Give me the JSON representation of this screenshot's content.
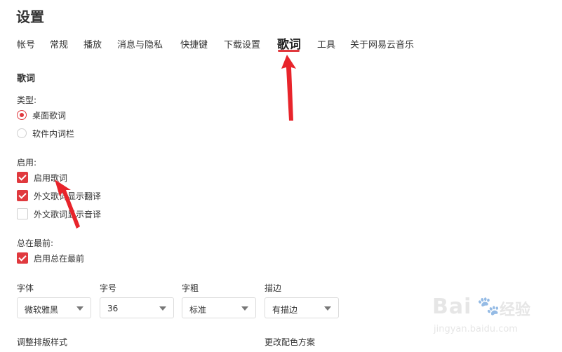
{
  "page": {
    "title": "设置"
  },
  "tabs": [
    {
      "label": "帐号"
    },
    {
      "label": "常规"
    },
    {
      "label": "播放"
    },
    {
      "label": "消息与隐私"
    },
    {
      "label": "快捷键"
    },
    {
      "label": "下载设置"
    },
    {
      "label": "歌词",
      "active": true
    },
    {
      "label": "工具"
    },
    {
      "label": "关于网易云音乐"
    }
  ],
  "lyrics": {
    "section_title": "歌词",
    "type_label": "类型:",
    "type_options": [
      {
        "label": "桌面歌词",
        "selected": true
      },
      {
        "label": "软件内词栏",
        "selected": false
      }
    ],
    "enable_label": "启用:",
    "enable_options": [
      {
        "label": "启用歌词",
        "checked": true
      },
      {
        "label": "外文歌词显示翻译",
        "checked": true
      },
      {
        "label": "外文歌词显示音译",
        "checked": false
      }
    ],
    "top_label": "总在最前:",
    "top_option": {
      "label": "启用总在最前",
      "checked": true
    },
    "font": {
      "font_label": "字体",
      "font_value": "微软雅黑",
      "size_label": "字号",
      "size_value": "36",
      "weight_label": "字粗",
      "weight_value": "标准",
      "outline_label": "描边",
      "outline_value": "有描边"
    },
    "layout_label": "调整排版样式",
    "color_label": "更改配色方案"
  },
  "colors": {
    "accent": "#e0393e"
  },
  "watermark": {
    "brand": "Bai",
    "paw": "🐾",
    "text": "经验",
    "url": "jingyan.baidu.com"
  }
}
